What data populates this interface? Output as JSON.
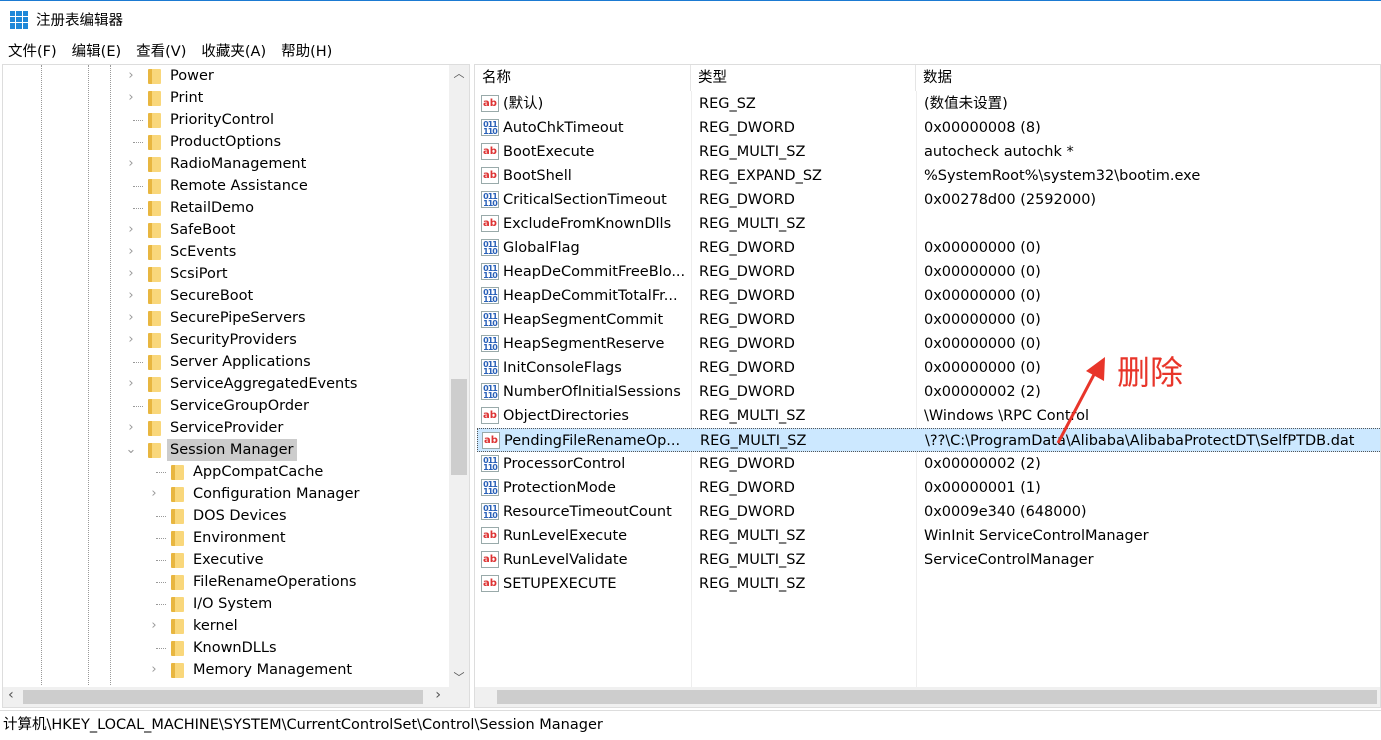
{
  "window": {
    "title": "注册表编辑器"
  },
  "menu": [
    "文件(F)",
    "编辑(E)",
    "查看(V)",
    "收藏夹(A)",
    "帮助(H)"
  ],
  "tree": [
    {
      "label": "Power",
      "level": 1,
      "expandable": true
    },
    {
      "label": "Print",
      "level": 1,
      "expandable": true
    },
    {
      "label": "PriorityControl",
      "level": 1,
      "expandable": false
    },
    {
      "label": "ProductOptions",
      "level": 1,
      "expandable": false
    },
    {
      "label": "RadioManagement",
      "level": 1,
      "expandable": true
    },
    {
      "label": "Remote Assistance",
      "level": 1,
      "expandable": false
    },
    {
      "label": "RetailDemo",
      "level": 1,
      "expandable": false
    },
    {
      "label": "SafeBoot",
      "level": 1,
      "expandable": true
    },
    {
      "label": "ScEvents",
      "level": 1,
      "expandable": true
    },
    {
      "label": "ScsiPort",
      "level": 1,
      "expandable": true
    },
    {
      "label": "SecureBoot",
      "level": 1,
      "expandable": true
    },
    {
      "label": "SecurePipeServers",
      "level": 1,
      "expandable": true
    },
    {
      "label": "SecurityProviders",
      "level": 1,
      "expandable": true
    },
    {
      "label": "Server Applications",
      "level": 1,
      "expandable": false
    },
    {
      "label": "ServiceAggregatedEvents",
      "level": 1,
      "expandable": true
    },
    {
      "label": "ServiceGroupOrder",
      "level": 1,
      "expandable": false
    },
    {
      "label": "ServiceProvider",
      "level": 1,
      "expandable": true
    },
    {
      "label": "Session Manager",
      "level": 1,
      "expandable": true,
      "expanded": true,
      "selected": true
    },
    {
      "label": "AppCompatCache",
      "level": 2,
      "expandable": false
    },
    {
      "label": "Configuration Manager",
      "level": 2,
      "expandable": true
    },
    {
      "label": "DOS Devices",
      "level": 2,
      "expandable": false
    },
    {
      "label": "Environment",
      "level": 2,
      "expandable": false
    },
    {
      "label": "Executive",
      "level": 2,
      "expandable": false
    },
    {
      "label": "FileRenameOperations",
      "level": 2,
      "expandable": false
    },
    {
      "label": "I/O System",
      "level": 2,
      "expandable": false
    },
    {
      "label": "kernel",
      "level": 2,
      "expandable": true
    },
    {
      "label": "KnownDLLs",
      "level": 2,
      "expandable": false
    },
    {
      "label": "Memory Management",
      "level": 2,
      "expandable": true
    }
  ],
  "columns": [
    "名称",
    "类型",
    "数据"
  ],
  "values": [
    {
      "name": "(默认)",
      "type": "REG_SZ",
      "data": "(数值未设置)",
      "icon": "ab"
    },
    {
      "name": "AutoChkTimeout",
      "type": "REG_DWORD",
      "data": "0x00000008 (8)",
      "icon": "dword"
    },
    {
      "name": "BootExecute",
      "type": "REG_MULTI_SZ",
      "data": "autocheck autochk *",
      "icon": "ab"
    },
    {
      "name": "BootShell",
      "type": "REG_EXPAND_SZ",
      "data": "%SystemRoot%\\system32\\bootim.exe",
      "icon": "ab"
    },
    {
      "name": "CriticalSectionTimeout",
      "type": "REG_DWORD",
      "data": "0x00278d00 (2592000)",
      "icon": "dword"
    },
    {
      "name": "ExcludeFromKnownDlls",
      "type": "REG_MULTI_SZ",
      "data": "",
      "icon": "ab"
    },
    {
      "name": "GlobalFlag",
      "type": "REG_DWORD",
      "data": "0x00000000 (0)",
      "icon": "dword"
    },
    {
      "name": "HeapDeCommitFreeBlo...",
      "type": "REG_DWORD",
      "data": "0x00000000 (0)",
      "icon": "dword"
    },
    {
      "name": "HeapDeCommitTotalFr...",
      "type": "REG_DWORD",
      "data": "0x00000000 (0)",
      "icon": "dword"
    },
    {
      "name": "HeapSegmentCommit",
      "type": "REG_DWORD",
      "data": "0x00000000 (0)",
      "icon": "dword"
    },
    {
      "name": "HeapSegmentReserve",
      "type": "REG_DWORD",
      "data": "0x00000000 (0)",
      "icon": "dword"
    },
    {
      "name": "InitConsoleFlags",
      "type": "REG_DWORD",
      "data": "0x00000000 (0)",
      "icon": "dword"
    },
    {
      "name": "NumberOfInitialSessions",
      "type": "REG_DWORD",
      "data": "0x00000002 (2)",
      "icon": "dword"
    },
    {
      "name": "ObjectDirectories",
      "type": "REG_MULTI_SZ",
      "data": "\\Windows \\RPC Control",
      "icon": "ab"
    },
    {
      "name": "PendingFileRenameOp...",
      "type": "REG_MULTI_SZ",
      "data": "\\??\\C:\\ProgramData\\Alibaba\\AlibabaProtectDT\\SelfPTDB.dat",
      "icon": "ab",
      "selected": true
    },
    {
      "name": "ProcessorControl",
      "type": "REG_DWORD",
      "data": "0x00000002 (2)",
      "icon": "dword"
    },
    {
      "name": "ProtectionMode",
      "type": "REG_DWORD",
      "data": "0x00000001 (1)",
      "icon": "dword"
    },
    {
      "name": "ResourceTimeoutCount",
      "type": "REG_DWORD",
      "data": "0x0009e340 (648000)",
      "icon": "dword"
    },
    {
      "name": "RunLevelExecute",
      "type": "REG_MULTI_SZ",
      "data": "WinInit ServiceControlManager",
      "icon": "ab"
    },
    {
      "name": "RunLevelValidate",
      "type": "REG_MULTI_SZ",
      "data": "ServiceControlManager",
      "icon": "ab"
    },
    {
      "name": "SETUPEXECUTE",
      "type": "REG_MULTI_SZ",
      "data": "",
      "icon": "ab"
    }
  ],
  "annotation": {
    "text": "删除",
    "color": "#e8352a"
  },
  "status": "计算机\\HKEY_LOCAL_MACHINE\\SYSTEM\\CurrentControlSet\\Control\\Session Manager"
}
